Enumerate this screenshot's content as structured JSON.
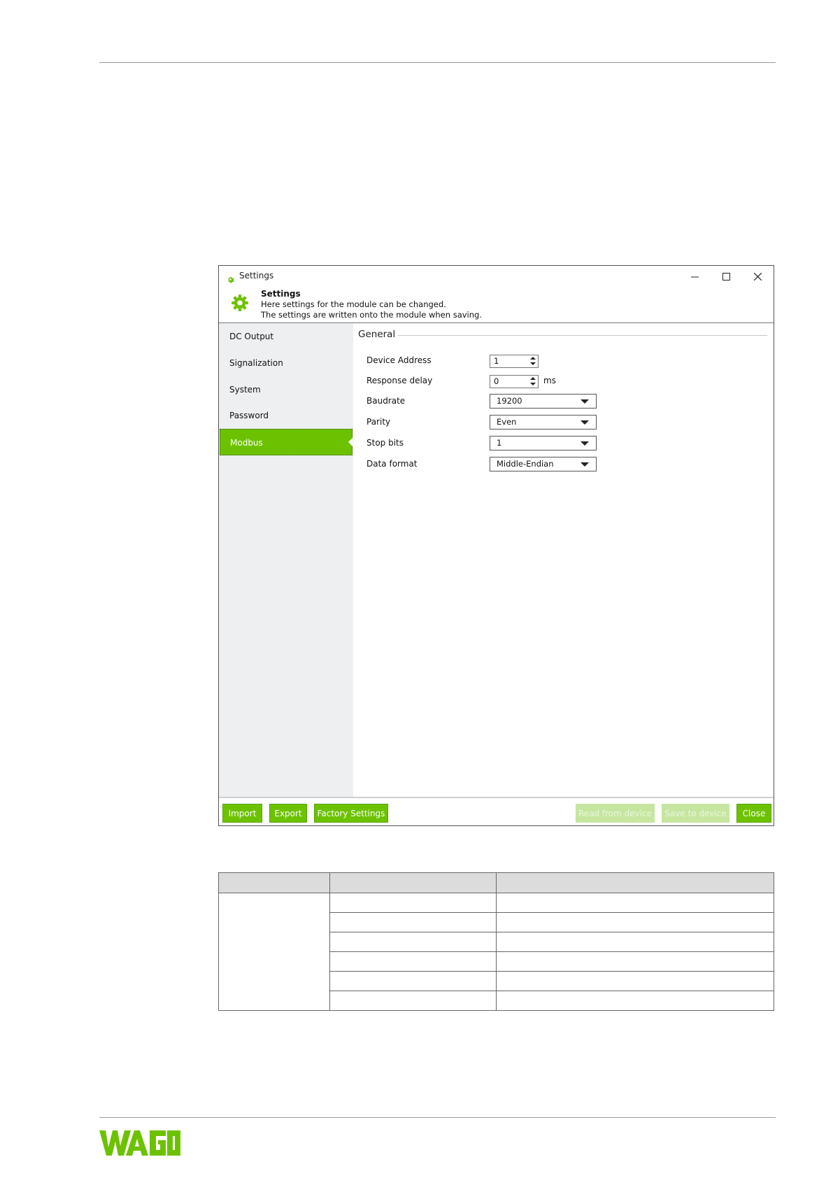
{
  "window": {
    "title": "Settings",
    "header": {
      "title": "Settings",
      "line1": "Here settings for the module can be changed.",
      "line2": "The settings are written onto the module when saving."
    }
  },
  "sidebar": {
    "items": [
      {
        "label": "DC Output",
        "active": false
      },
      {
        "label": "Signalization",
        "active": false
      },
      {
        "label": "System",
        "active": false
      },
      {
        "label": "Password",
        "active": false
      },
      {
        "label": "Modbus",
        "active": true
      }
    ]
  },
  "general": {
    "title": "General",
    "device_address": {
      "label": "Device Address",
      "value": "1"
    },
    "response_delay": {
      "label": "Response delay",
      "value": "0",
      "unit": "ms"
    },
    "baudrate": {
      "label": "Baudrate",
      "value": "19200"
    },
    "parity": {
      "label": "Parity",
      "value": "Even"
    },
    "stop_bits": {
      "label": "Stop bits",
      "value": "1"
    },
    "data_format": {
      "label": "Data format",
      "value": "Middle-Endian"
    }
  },
  "footer": {
    "import": "Import",
    "export": "Export",
    "factory": "Factory Settings",
    "read": "Read from device",
    "save": "Save to device",
    "close": "Close"
  },
  "colors": {
    "accent": "#6dc200",
    "accent_disabled": "#c6e6a0",
    "sidebar_bg": "#eeeff0"
  }
}
